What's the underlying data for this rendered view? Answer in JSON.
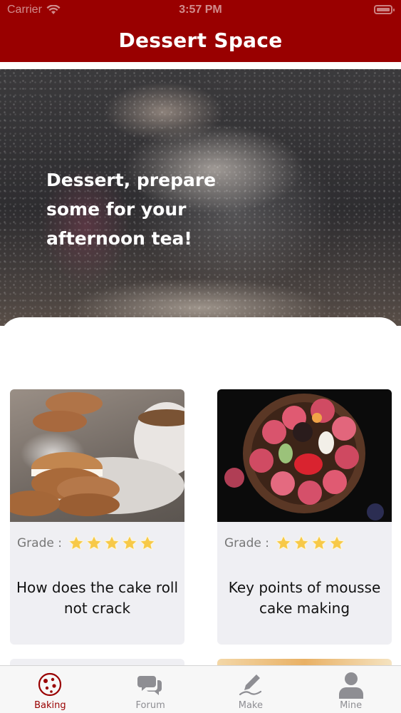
{
  "status_bar": {
    "carrier": "Carrier",
    "time": "3:57 PM"
  },
  "header": {
    "title": "Dessert Space"
  },
  "hero": {
    "text": "Dessert, prepare some for your afternoon tea!"
  },
  "cards": [
    {
      "grade_label": "Grade :",
      "rating": 5,
      "title": "How does the cake roll not crack"
    },
    {
      "grade_label": "Grade :",
      "rating": 4,
      "title": "Key points of mousse cake making"
    }
  ],
  "tabs": [
    {
      "label": "Baking",
      "icon": "cookie-icon",
      "active": true
    },
    {
      "label": "Forum",
      "icon": "chat-bubbles-icon",
      "active": false
    },
    {
      "label": "Make",
      "icon": "pen-icon",
      "active": false
    },
    {
      "label": "Mine",
      "icon": "person-icon",
      "active": false
    }
  ],
  "colors": {
    "brand": "#990000",
    "card_bg": "#efeff3",
    "star": "#f7c948"
  }
}
